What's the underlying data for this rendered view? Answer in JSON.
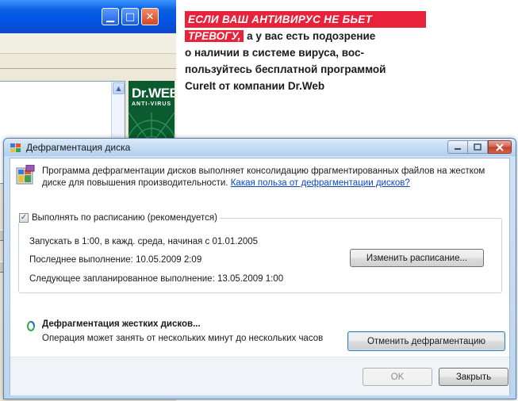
{
  "caption": {
    "line1": "ЕСЛИ ВАШ АНТИВИРУС НЕ БЬЕТ",
    "line2_highlight": "ТРЕВОГУ,",
    "line2_rest": " а у вас есть подозрение",
    "line3": "о наличии в системе вируса, вос-",
    "line4": "пользуйтесь бесплатной программой",
    "line5": "CureIt от компании Dr.Web"
  },
  "background_window": {
    "logo_text": "Dr.WEB",
    "logo_subtext": "ANTI-VIRUS"
  },
  "dialog": {
    "title": "Дефрагментация диска",
    "description": "Программа дефрагментации дисков выполняет консолидацию фрагментированных файлов на жестком диске для повышения производительности.",
    "help_link": "Какая польза от дефрагментации дисков?",
    "schedule_checkbox_label": "Выполнять по расписанию (рекомендуется)",
    "schedule_checked": true,
    "run_info": "Запускать в 1:00, в кажд. среда, начиная с 01.01.2005",
    "last_run": "Последнее выполнение: 10.05.2009 2:09",
    "next_run": "Следующее запланированное выполнение: 13.05.2009 1:00",
    "change_schedule_button": "Изменить расписание...",
    "status_title": "Дефрагментация жестких дисков...",
    "status_note": "Операция может занять от нескольких минут до нескольких часов",
    "cancel_button": "Отменить дефрагментацию",
    "ok_button": "OK",
    "close_button": "Закрыть"
  },
  "colors": {
    "highlight_red": "#e8223a",
    "link_blue": "#0c45c9",
    "xp_titlebar_blue": "#0055e5"
  }
}
